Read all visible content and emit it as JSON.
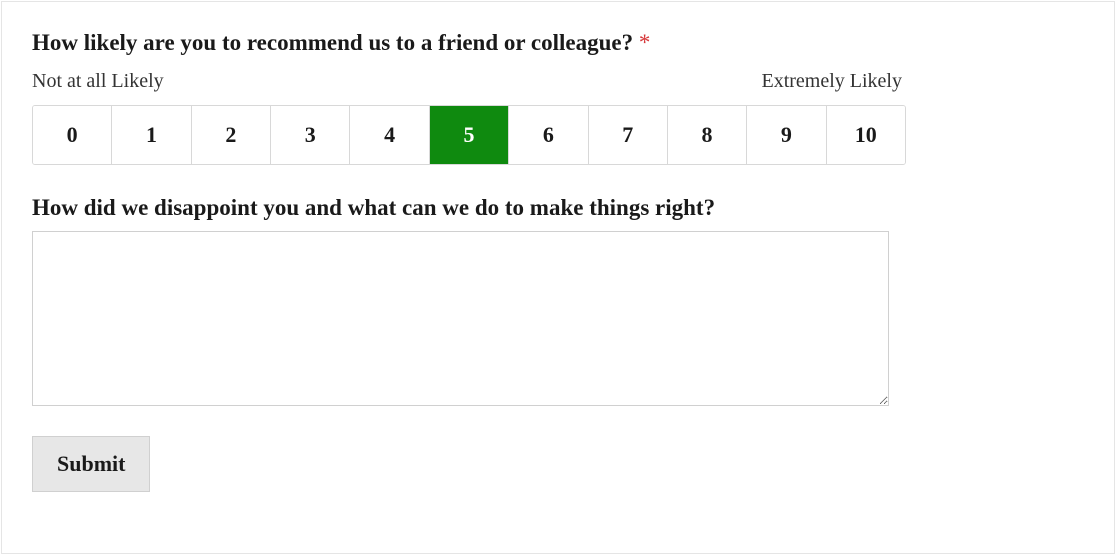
{
  "question1": {
    "title": "How likely are you to recommend us to a friend or colleague?",
    "required_mark": "*",
    "low_label": "Not at all Likely",
    "high_label": "Extremely Likely",
    "options": [
      "0",
      "1",
      "2",
      "3",
      "4",
      "5",
      "6",
      "7",
      "8",
      "9",
      "10"
    ],
    "selected": "5"
  },
  "question2": {
    "title": "How did we disappoint you and what can we do to make things right?",
    "value": ""
  },
  "submit": {
    "label": "Submit"
  }
}
